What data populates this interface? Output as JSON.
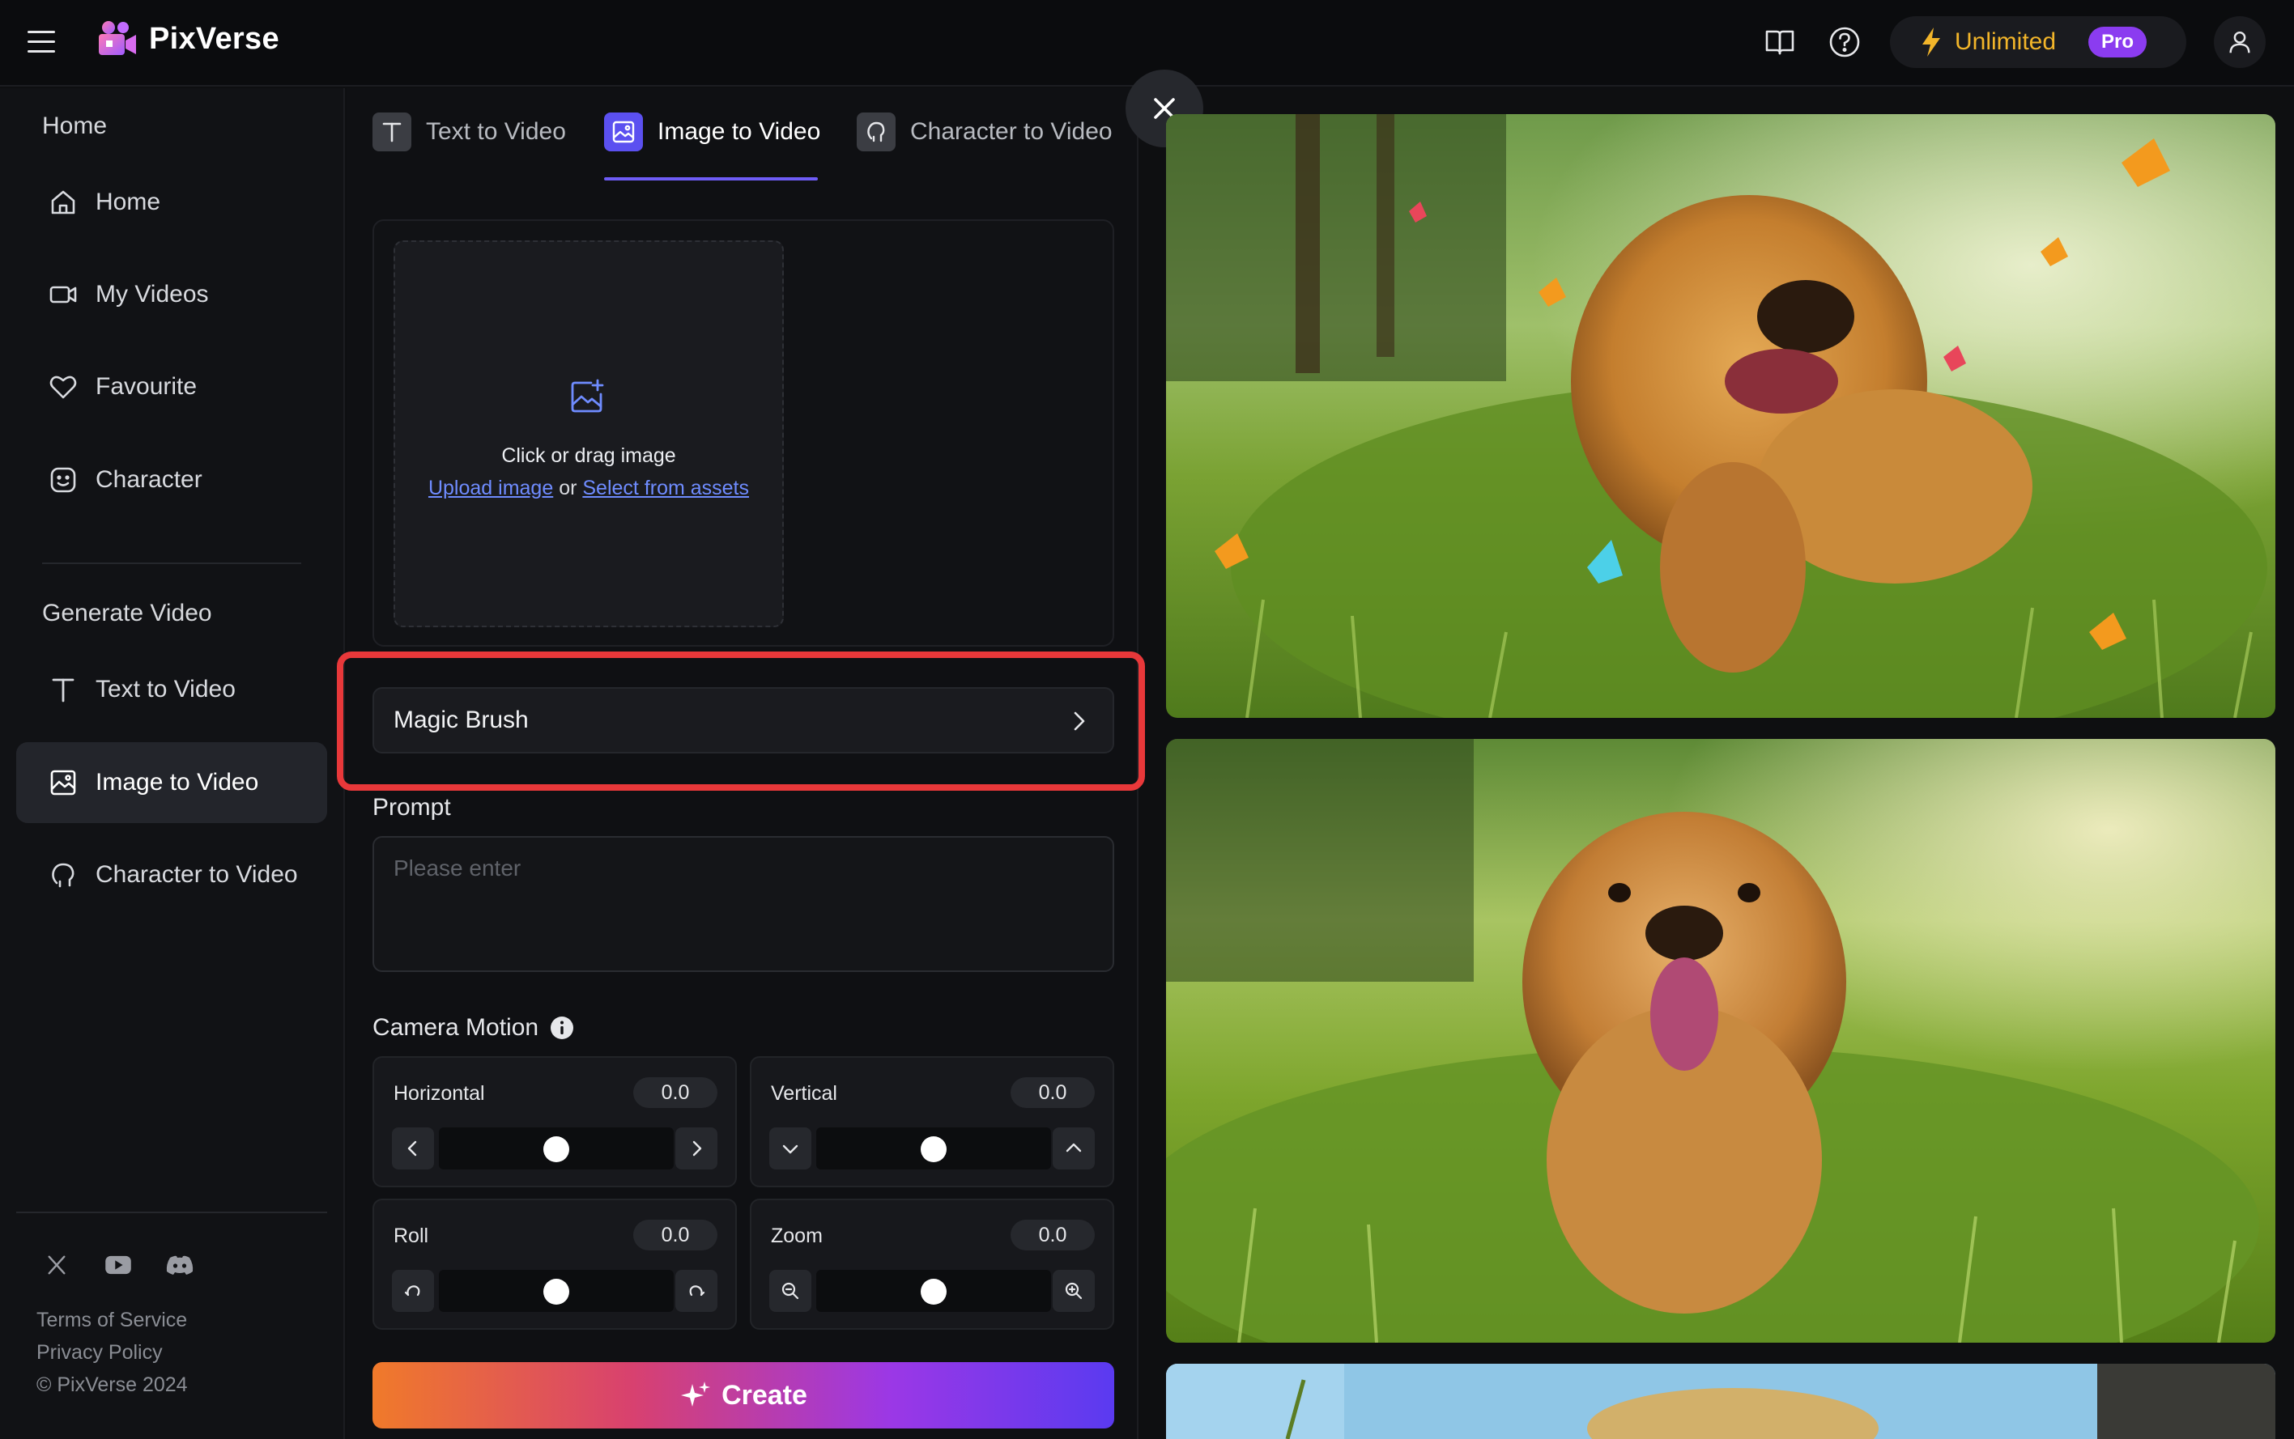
{
  "app": {
    "name": "PixVerse"
  },
  "topbar": {
    "plan_label": "Unlimited",
    "plan_badge": "Pro",
    "accent_color": "#f2b52a",
    "badge_color": "#8b3cf0"
  },
  "sidebar": {
    "section_home": "Home",
    "home_items": [
      {
        "label": "Home",
        "icon": "home-icon"
      },
      {
        "label": "My Videos",
        "icon": "video-camera-icon"
      },
      {
        "label": "Favourite",
        "icon": "heart-icon"
      },
      {
        "label": "Character",
        "icon": "smiley-icon"
      }
    ],
    "section_generate": "Generate Video",
    "generate_items": [
      {
        "label": "Text to Video",
        "icon": "text-icon"
      },
      {
        "label": "Image to Video",
        "icon": "image-icon",
        "active": true
      },
      {
        "label": "Character to Video",
        "icon": "character-icon"
      }
    ],
    "footer": {
      "terms": "Terms of Service",
      "privacy": "Privacy Policy",
      "copyright": "© PixVerse 2024"
    }
  },
  "panel": {
    "tabs": [
      {
        "label": "Text to Video"
      },
      {
        "label": "Image to Video",
        "active": true
      },
      {
        "label": "Character to Video"
      }
    ],
    "upload": {
      "instruction": "Click or drag image",
      "upload_link": "Upload image",
      "or_text": "or",
      "assets_link": "Select from assets"
    },
    "magic_brush_label": "Magic Brush",
    "prompt": {
      "label": "Prompt",
      "placeholder": "Please enter",
      "value": ""
    },
    "camera_motion": {
      "label": "Camera Motion",
      "controls": [
        {
          "name": "Horizontal",
          "value": "0.0",
          "level": 0.5
        },
        {
          "name": "Vertical",
          "value": "0.0",
          "level": 0.5
        },
        {
          "name": "Roll",
          "value": "0.0",
          "level": 0.5
        },
        {
          "name": "Zoom",
          "value": "0.0",
          "level": 0.5
        }
      ]
    },
    "create_label": "Create",
    "highlight_color": "#e8383a"
  }
}
